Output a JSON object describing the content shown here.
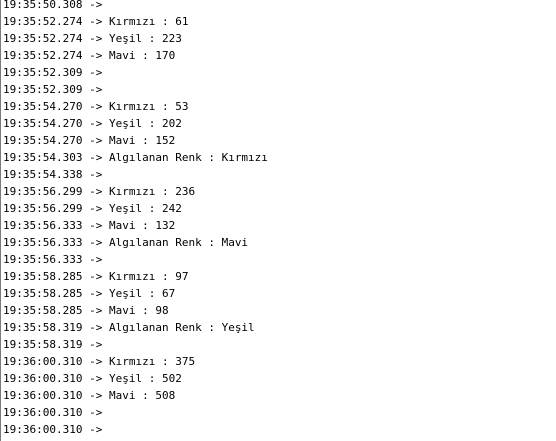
{
  "serial_monitor": {
    "lines": [
      {
        "time": "19:35:50.308",
        "arrow": "->",
        "message": ""
      },
      {
        "time": "19:35:52.274",
        "arrow": "->",
        "message": "Kırmızı : 61"
      },
      {
        "time": "19:35:52.274",
        "arrow": "->",
        "message": "Yeşil : 223"
      },
      {
        "time": "19:35:52.274",
        "arrow": "->",
        "message": "Mavi : 170"
      },
      {
        "time": "19:35:52.309",
        "arrow": "->",
        "message": ""
      },
      {
        "time": "19:35:52.309",
        "arrow": "->",
        "message": ""
      },
      {
        "time": "19:35:54.270",
        "arrow": "->",
        "message": "Kırmızı : 53"
      },
      {
        "time": "19:35:54.270",
        "arrow": "->",
        "message": "Yeşil : 202"
      },
      {
        "time": "19:35:54.270",
        "arrow": "->",
        "message": "Mavi : 152"
      },
      {
        "time": "19:35:54.303",
        "arrow": "->",
        "message": "Algılanan Renk : Kırmızı"
      },
      {
        "time": "19:35:54.338",
        "arrow": "->",
        "message": ""
      },
      {
        "time": "19:35:56.299",
        "arrow": "->",
        "message": "Kırmızı : 236"
      },
      {
        "time": "19:35:56.299",
        "arrow": "->",
        "message": "Yeşil : 242"
      },
      {
        "time": "19:35:56.333",
        "arrow": "->",
        "message": "Mavi : 132"
      },
      {
        "time": "19:35:56.333",
        "arrow": "->",
        "message": "Algılanan Renk : Mavi"
      },
      {
        "time": "19:35:56.333",
        "arrow": "->",
        "message": ""
      },
      {
        "time": "19:35:58.285",
        "arrow": "->",
        "message": "Kırmızı : 97"
      },
      {
        "time": "19:35:58.285",
        "arrow": "->",
        "message": "Yeşil : 67"
      },
      {
        "time": "19:35:58.285",
        "arrow": "->",
        "message": "Mavi : 98"
      },
      {
        "time": "19:35:58.319",
        "arrow": "->",
        "message": "Algılanan Renk : Yeşil"
      },
      {
        "time": "19:35:58.319",
        "arrow": "->",
        "message": ""
      },
      {
        "time": "19:36:00.310",
        "arrow": "->",
        "message": "Kırmızı : 375"
      },
      {
        "time": "19:36:00.310",
        "arrow": "->",
        "message": "Yeşil : 502"
      },
      {
        "time": "19:36:00.310",
        "arrow": "->",
        "message": "Mavi : 508"
      },
      {
        "time": "19:36:00.310",
        "arrow": "->",
        "message": ""
      },
      {
        "time": "19:36:00.310",
        "arrow": "->",
        "message": ""
      }
    ]
  }
}
